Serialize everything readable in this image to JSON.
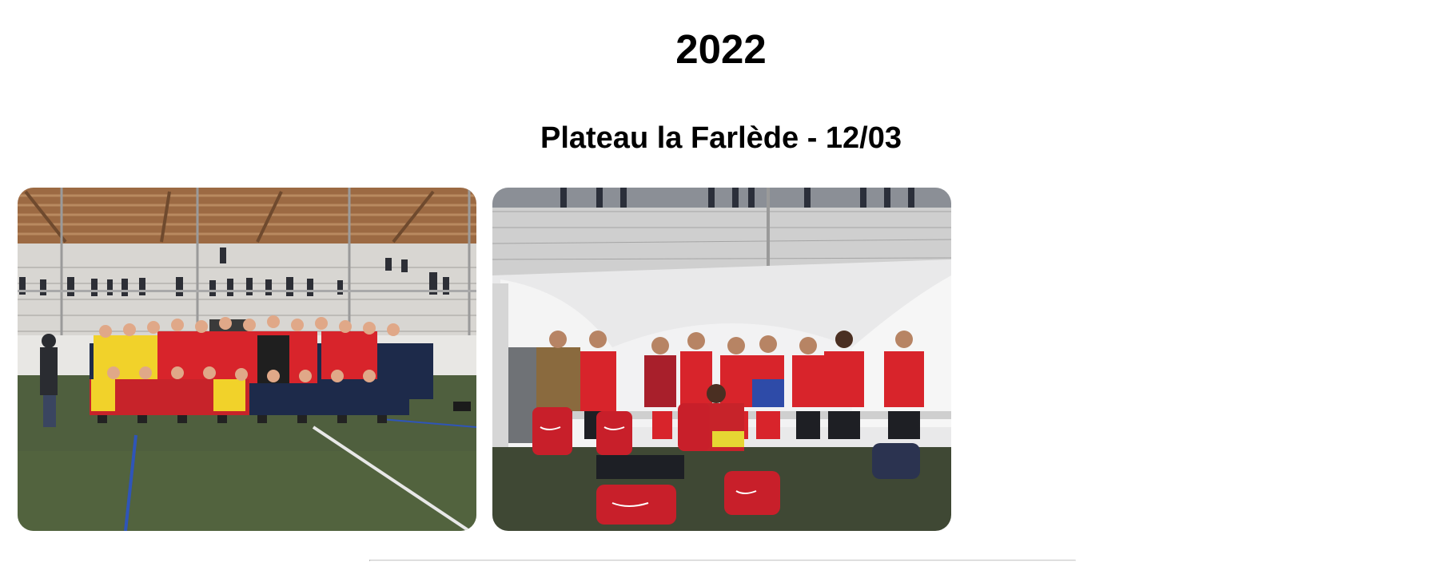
{
  "section": {
    "year": "2022",
    "event_title": "Plateau la Farlède - 12/03"
  },
  "gallery": {
    "photos": [
      {
        "alt": "Plateau la Farlède - 12/03 photo 1"
      },
      {
        "alt": "Plateau la Farlède - 12/03 photo 2"
      }
    ]
  },
  "colors": {
    "page_background": "#ffffff",
    "heading_text": "#000000",
    "divider": "#cfcfcf",
    "pitch_green": "#4f5f3e",
    "kit_red": "#d8242b",
    "kit_yellow": "#f1d22a",
    "kit_navy": "#1d2a4a"
  }
}
